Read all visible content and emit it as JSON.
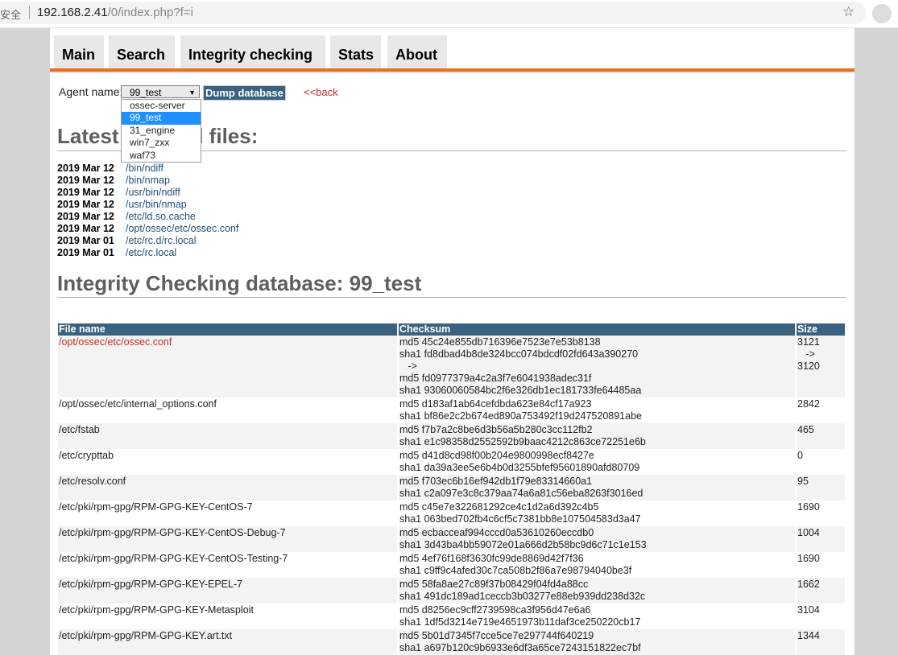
{
  "browser": {
    "security_text": "安全",
    "url_host": "192.168.2.41",
    "url_path": "/0/index.php?f=i"
  },
  "nav": {
    "tabs": [
      {
        "label": "Main"
      },
      {
        "label": "Search"
      },
      {
        "label": "Integrity checking"
      },
      {
        "label": "Stats"
      },
      {
        "label": "About"
      }
    ]
  },
  "agent": {
    "label": "Agent name:",
    "selected": "99_test",
    "dump_button": "Dump database",
    "back_link": "<<back",
    "options": [
      "ossec-server",
      "99_test",
      "31_engine",
      "win7_zxx",
      "waf73"
    ]
  },
  "latest": {
    "heading_left": "Latest",
    "heading_right": "d files:",
    "files": [
      {
        "date": "2019 Mar 12",
        "path": "/bin/ndiff"
      },
      {
        "date": "2019 Mar 12",
        "path": "/bin/nmap"
      },
      {
        "date": "2019 Mar 12",
        "path": "/usr/bin/ndiff"
      },
      {
        "date": "2019 Mar 12",
        "path": "/usr/bin/nmap"
      },
      {
        "date": "2019 Mar 12",
        "path": "/etc/ld.so.cache"
      },
      {
        "date": "2019 Mar 12",
        "path": "/opt/ossec/etc/ossec.conf"
      },
      {
        "date": "2019 Mar 01",
        "path": "/etc/rc.d/rc.local"
      },
      {
        "date": "2019 Mar 01",
        "path": "/etc/rc.local"
      }
    ]
  },
  "db": {
    "heading": "Integrity Checking database: 99_test",
    "columns": [
      "File name",
      "Checksum",
      "Size"
    ],
    "rows": [
      {
        "file": "/opt/ossec/etc/ossec.conf",
        "checksum": "md5 45c24e855db716396e7523e7e53b8138\nsha1 fd8dbad4b8de324bcc074bdcdf02fd643a390270\n   ->\nmd5 fd0977379a4c2a3f7e6041938adec31f\nsha1 93060060584bc2f6e326db1ec181733fe64485aa",
        "size": "3121\n   ->\n3120"
      },
      {
        "file": "/opt/ossec/etc/internal_options.conf",
        "checksum": "md5 d183af1ab64cefdbda623e84cf17a923\nsha1 bf86e2c2b674ed890a753492f19d247520891abe",
        "size": "2842"
      },
      {
        "file": "/etc/fstab",
        "checksum": "md5 f7b7a2c8be6d3b56a5b280c3cc112fb2\nsha1 e1c98358d2552592b9baac4212c863ce72251e6b",
        "size": "465"
      },
      {
        "file": "/etc/crypttab",
        "checksum": "md5 d41d8cd98f00b204e9800998ecf8427e\nsha1 da39a3ee5e6b4b0d3255bfef95601890afd80709",
        "size": "0"
      },
      {
        "file": "/etc/resolv.conf",
        "checksum": "md5 f703ec6b16ef942db1f79e83314660a1\nsha1 c2a097e3c8c379aa74a6a81c56eba8263f3016ed",
        "size": "95"
      },
      {
        "file": "/etc/pki/rpm-gpg/RPM-GPG-KEY-CentOS-7",
        "checksum": "md5 c45e7e322681292ce4c1d2a6d392c4b5\nsha1 063bed702fb4c6cf5c7381bb8e107504583d3a47",
        "size": "1690"
      },
      {
        "file": "/etc/pki/rpm-gpg/RPM-GPG-KEY-CentOS-Debug-7",
        "checksum": "md5 ecbacceaf994cccd0a53610260eccdb0\nsha1 3d43ba4bb59072e01a666d2b58bc9d6c71c1e153",
        "size": "1004"
      },
      {
        "file": "/etc/pki/rpm-gpg/RPM-GPG-KEY-CentOS-Testing-7",
        "checksum": "md5 4ef76f168f3630fc99de8869d42f7f36\nsha1 c9ff9c4afed30c7ca508b2f86a7e98794040be3f",
        "size": "1690"
      },
      {
        "file": "/etc/pki/rpm-gpg/RPM-GPG-KEY-EPEL-7",
        "checksum": "md5 58fa8ae27c89f37b08429f04fd4a88cc\nsha1 491dc189ad1ceccb3b03277e88eb939dd238d32c",
        "size": "1662"
      },
      {
        "file": "/etc/pki/rpm-gpg/RPM-GPG-KEY-Metasploit",
        "checksum": "md5 d8256ec9cff2739598ca3f956d47e6a6\nsha1 1df5d3214e719e4651973b11daf3ce250220cb17",
        "size": "3104"
      },
      {
        "file": "/etc/pki/rpm-gpg/RPM-GPG-KEY.art.txt",
        "checksum": "md5 5b01d7345f7cce5ce7e297744f640219\nsha1 a697b120c9b6933e6df3a65ce7243151822ec7bf",
        "size": "1344"
      }
    ]
  }
}
